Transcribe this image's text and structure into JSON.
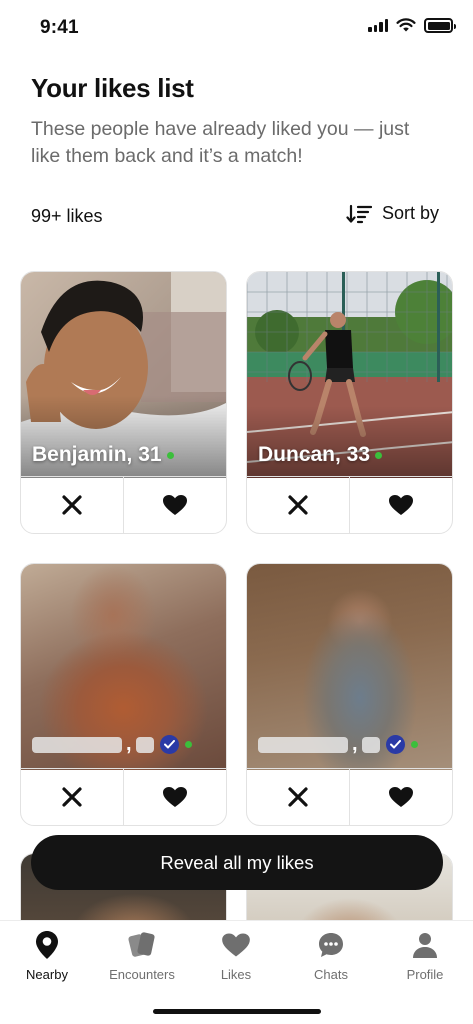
{
  "status_bar": {
    "time": "9:41"
  },
  "header": {
    "title": "Your likes list",
    "subtitle": "These people have already liked you — just like them back and it’s a match!"
  },
  "likes": {
    "count_label": "99+ likes",
    "sort_label": "Sort by"
  },
  "cards": [
    {
      "name": "Benjamin, 31",
      "online": true
    },
    {
      "name": "Duncan, 33",
      "online": true
    },
    {
      "name": "",
      "hidden": true,
      "verified": true
    },
    {
      "name": "",
      "hidden": true,
      "verified": true
    }
  ],
  "reveal_button": {
    "label": "Reveal all my likes"
  },
  "tab_bar": {
    "items": [
      {
        "label": "Nearby",
        "icon": "map-pin-icon",
        "active": true
      },
      {
        "label": "Encounters",
        "icon": "cards-icon"
      },
      {
        "label": "Likes",
        "icon": "heart-icon"
      },
      {
        "label": "Chats",
        "icon": "chat-bubble-icon"
      },
      {
        "label": "Profile",
        "icon": "person-icon"
      }
    ]
  },
  "colors": {
    "accent": "#141414",
    "online": "#3bbf3b",
    "verified": "#2a3aa6",
    "muted_text": "#6b6b6b"
  }
}
